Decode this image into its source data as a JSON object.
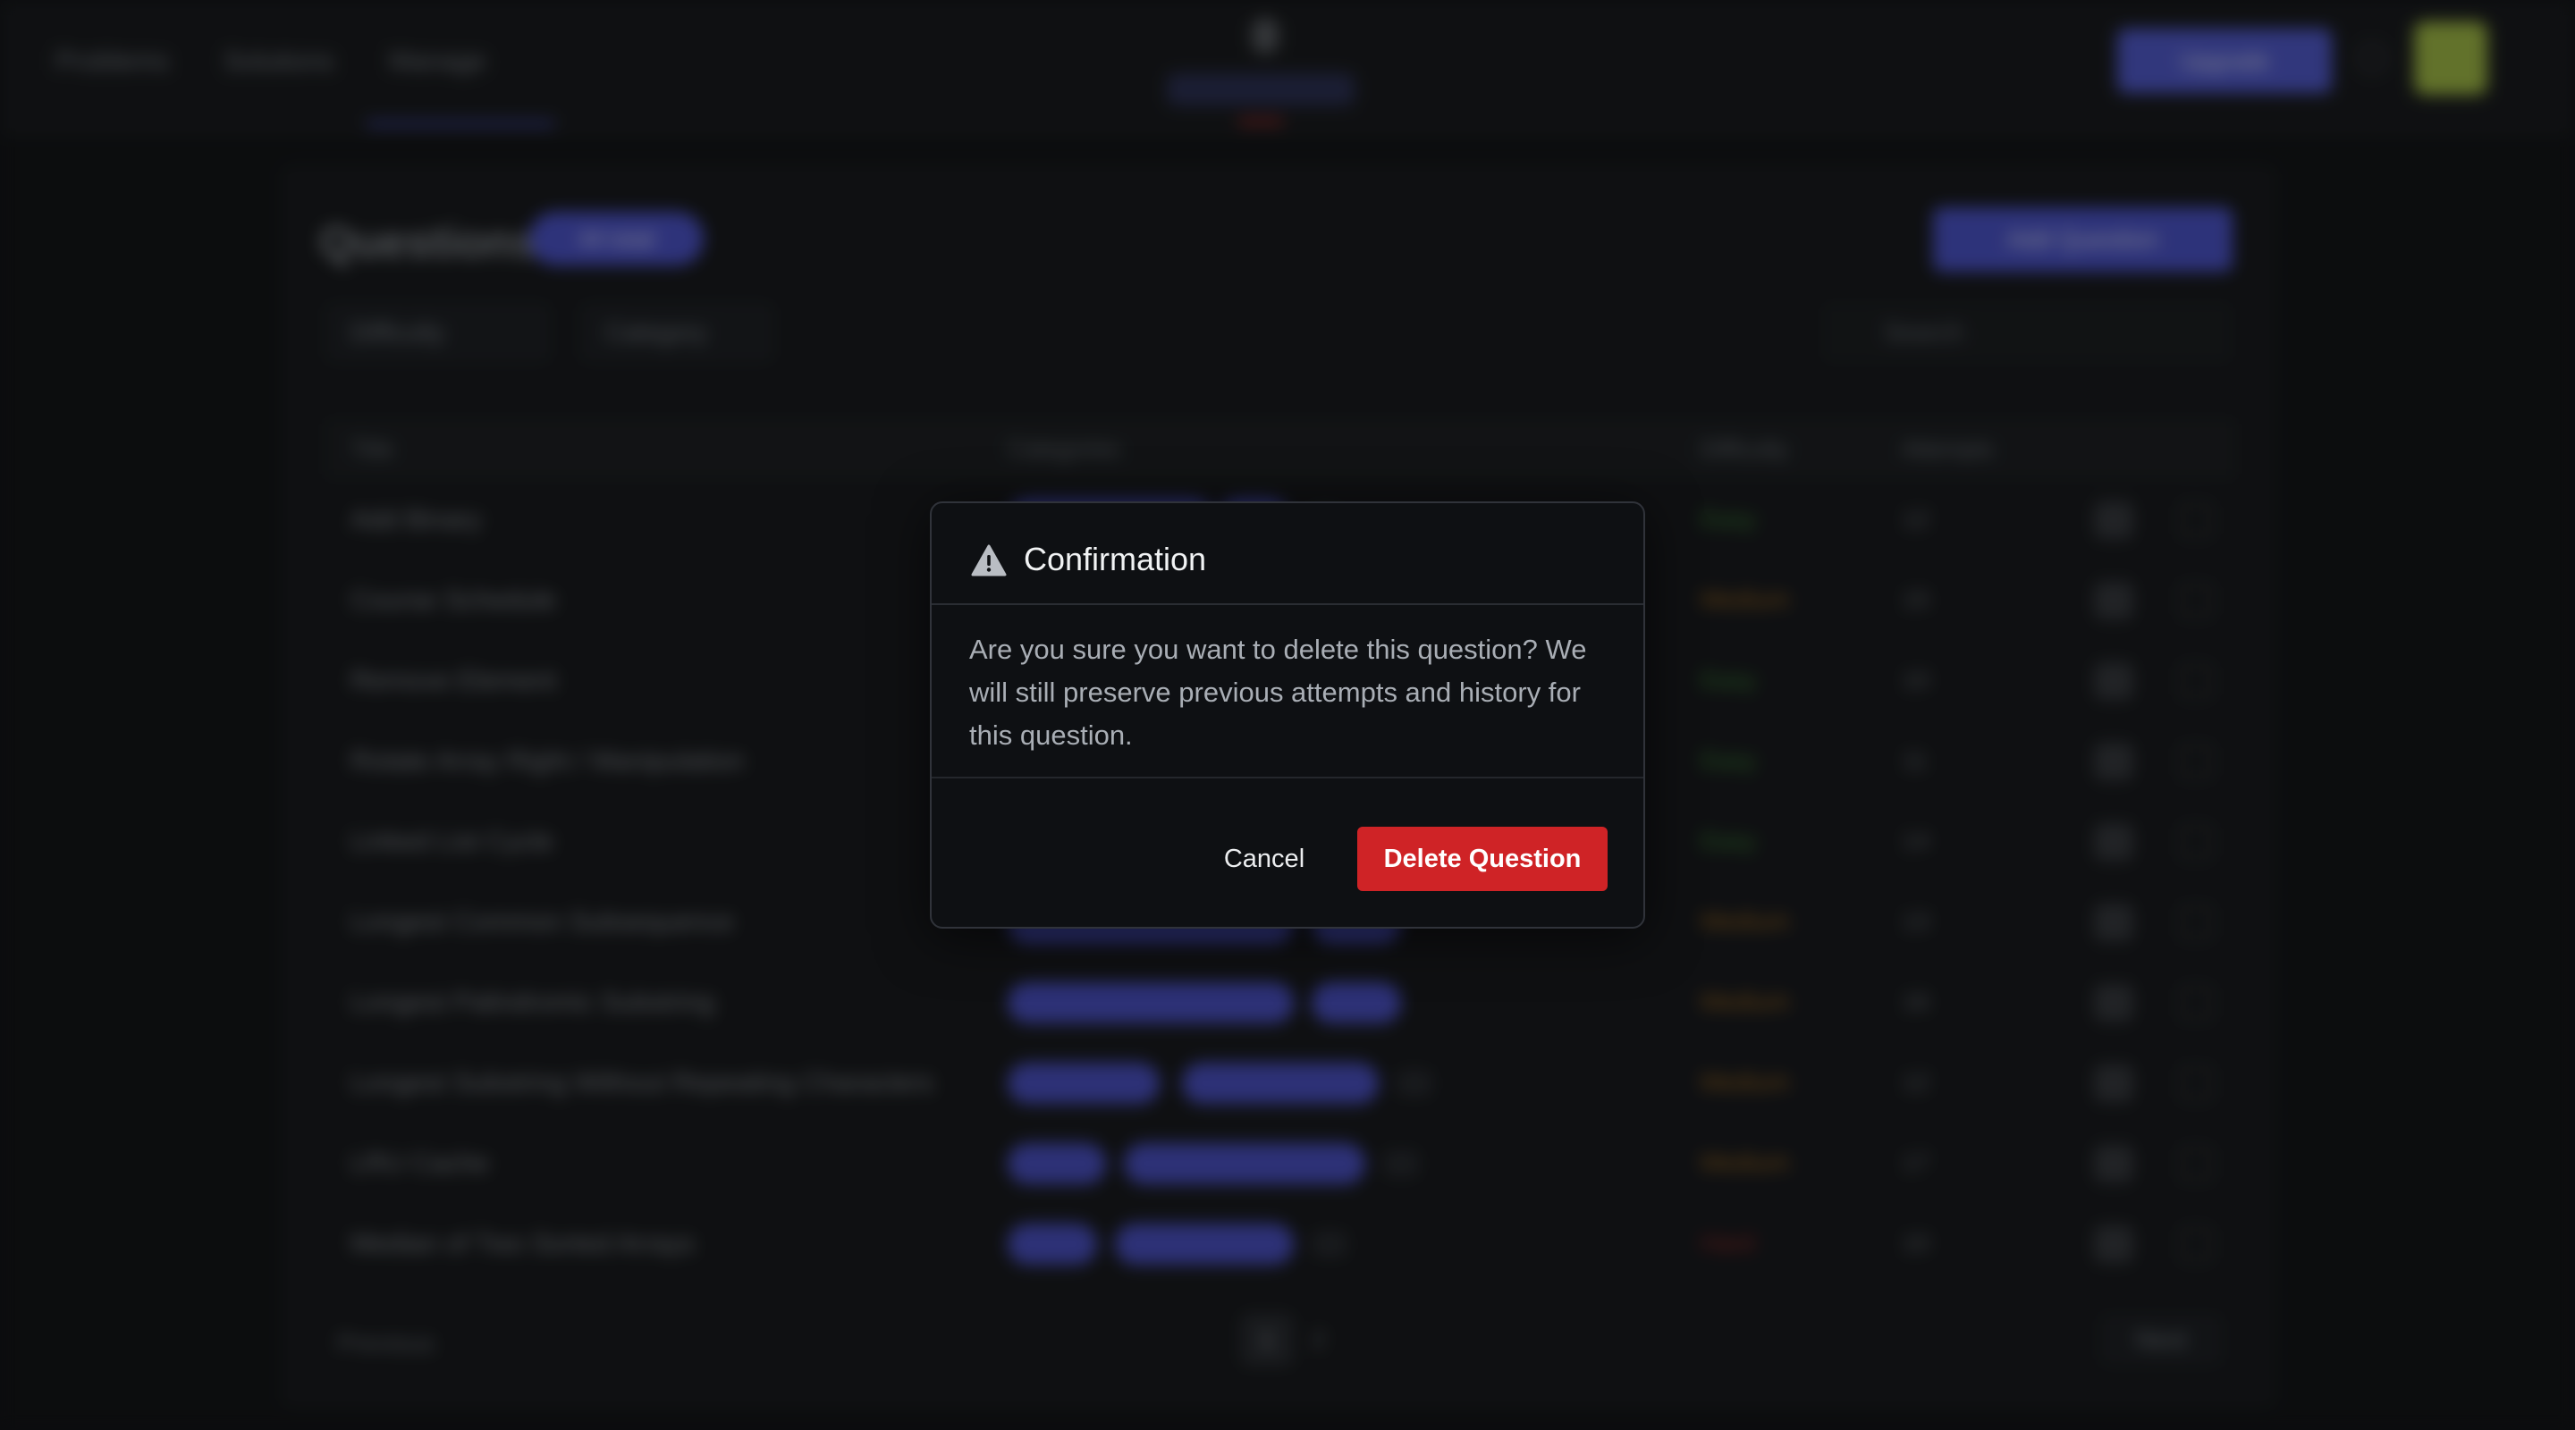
{
  "topbar": {
    "nav": [
      "Problems",
      "Solutions",
      "Manage"
    ],
    "upgrade_label": "Upgrade"
  },
  "questions": {
    "title": "Questions",
    "count_label": "44 total",
    "add_label": "Add Question",
    "filters": [
      "Difficulty",
      "Category"
    ],
    "search_placeholder": "Search",
    "columns": [
      "Title",
      "Categories",
      "Difficulty",
      "Attempts"
    ],
    "rows": [
      {
        "title": "Add Binary",
        "difficulty": "Easy",
        "attempts": "12"
      },
      {
        "title": "Course Schedule",
        "difficulty": "Medium",
        "attempts": "15"
      },
      {
        "title": "Remove Element",
        "difficulty": "Easy",
        "attempts": "10"
      },
      {
        "title": "Rotate Array Right / Manipulation",
        "difficulty": "Easy",
        "attempts": "11"
      },
      {
        "title": "Linked List Cycle",
        "difficulty": "Easy",
        "attempts": "14"
      },
      {
        "title": "Longest Common Subsequence",
        "difficulty": "Medium",
        "attempts": "13"
      },
      {
        "title": "Longest Palindromic Substring",
        "difficulty": "Medium",
        "attempts": "16"
      },
      {
        "title": "Longest Substring Without Repeating Characters",
        "difficulty": "Medium",
        "attempts": "12"
      },
      {
        "title": "LRU Cache",
        "difficulty": "Medium",
        "attempts": "17"
      },
      {
        "title": "Median of Two Sorted Arrays",
        "difficulty": "Hard",
        "attempts": "10"
      }
    ],
    "pager": {
      "prev": "Previous",
      "current": "1",
      "next_num": "2",
      "next": "Next"
    }
  },
  "dialog": {
    "title": "Confirmation",
    "icon": "warning-icon",
    "message": "Are you sure you want to delete this question? We will still preserve previous attempts and history for this question.",
    "cancel_label": "Cancel",
    "confirm_label": "Delete Question"
  },
  "colors": {
    "danger": "#cf2326",
    "accent": "#555fd6",
    "dialog_bg": "#0e1013",
    "easy": "#3e8a3a",
    "medium": "#a8701f",
    "hard": "#9a2a2a"
  }
}
